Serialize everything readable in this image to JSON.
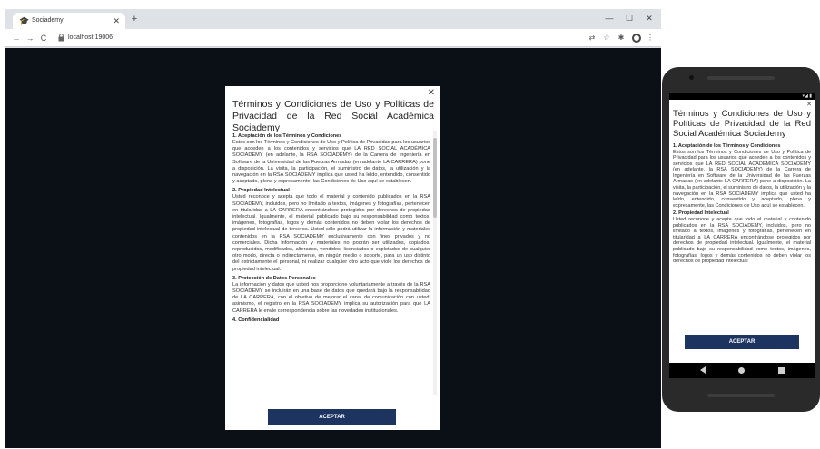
{
  "browser": {
    "tab_title": "Sociademy",
    "url": "localhost:19006",
    "icons": [
      "back-icon",
      "forward-icon",
      "reload-icon",
      "lock-icon",
      "translate-icon",
      "star-icon",
      "extensions-icon",
      "profile-icon",
      "menu-icon"
    ],
    "window_controls": {
      "minimize": "—",
      "maximize": "☐",
      "close": "✕"
    },
    "new_tab": "+",
    "tab_close": "✕"
  },
  "modal": {
    "close": "✕",
    "title": "Términos y Condiciones de Uso y Políticas de Privacidad de la Red Social Académica Sociademy",
    "sections": [
      {
        "heading": "1. Aceptación de los Términos y Condiciones",
        "text": "Estos son los Términos y Condiciones de Uso y Política de Privacidad para los usuarios que acceden a los contenidos y servicios que LA RED SOCIAL ACADÉMICA SOCIADEMY (en adelante, la RSA SOCIADEMY) de la Carrera de Ingeniería en Software de la Universidad de las Fuerzas Armadas (en adelante LA CARRERA) pone a disposición. La visita, la participación, el suministro de datos, la utilización y la navegación en la RSA SOCIADEMY implica que usted ha leído, entendido, consentido y aceptado, plena y expresamente, las Condiciones de Uso aquí se establecen."
      },
      {
        "heading": "2. Propiedad Intelectual",
        "text": "Usted reconoce y acepta que todo el material y contenido publicados en la RSA SOCIADEMY, incluidos, pero no limitado a textos, imágenes y fotografías, pertenecen en titularidad a LA CARRERA encontrándose protegidos por derechos de propiedad intelectual. Igualmente, el material publicado bajo su responsabilidad como textos, imágenes, fotografías, logos y demás contenidos no deben violar los derechos de propiedad intelectual de terceros. Usted sólo podrá utilizar la información y materiales contenidos en la RSA SOCIADEMY exclusivamente con fines privados y no comerciales. Dicha información y materiales no podrán ser utilizados, copiados, reproducidos, modificados, alterados, vendidos, licenciados o explotados de cualquier otro modo, directa o indirectamente, en ningún medio o soporte, para un uso distinto del estrictamente el personal, ni realizar cualquier otro acto que viole los derechos de propiedad intelectual."
      },
      {
        "heading": "3. Protección de Datos Personales",
        "text": "La información y datos que usted nos proporcione voluntariamente a través de la RSA SOCIADEMY se incluirán en una base de datos que quedará bajo la responsabilidad de LA CARRERA, con el objetivo de mejorar el canal de comunicación con usted, asimismo, el registro en la RSA SOCIADEMY implica su autorización para que LA CARRERA le envíe correspondencia sobre las novedades institucionales."
      },
      {
        "heading": "4. Confidencialidad",
        "text": ""
      }
    ],
    "accept_label": "ACEPTAR"
  },
  "phone": {
    "status_icons": "▾◢ ▮",
    "close": "✕",
    "title": "Términos y Condiciones de Uso y Políticas de Privacidad de la Red Social Académica Sociademy",
    "sections": [
      {
        "heading": "1. Aceptación de los Términos y Condiciones",
        "text": "Estos son los Términos y Condiciones de Uso y Política de Privacidad para los usuarios que acceden a los contenidos y servicios que LA RED SOCIAL ACADÉMICA SOCIADEMY (en adelante, la RSA SOCIADEMY) de la Carrera de Ingeniería en Software de la Universidad de las Fuerzas Armadas (en adelante LA CARRERA) pone a disposición. La visita, la participación, el suministro de datos, la utilización y la navegación en la RSA SOCIADEMY implica que usted ha leído, entendido, consentido y aceptado, plena y expresamente, las Condiciones de Uso aquí se establecen."
      },
      {
        "heading": "2. Propiedad Intelectual",
        "text": "Usted reconoce y acepta que todo el material y contenido publicados en la RSA SOCIADEMY, incluidos, pero no limitado a textos, imágenes y fotografías, pertenecen en titularidad a LA CARRERA encontrándose protegidos por derechos de propiedad intelectual. Igualmente, el material publicado bajo su responsabilidad como textos, imágenes, fotografías, logos y demás contenidos no deben violar los derechos de propiedad intelectual"
      }
    ],
    "accept_label": "ACEPTAR"
  },
  "colors": {
    "accent": "#1d3461",
    "page_background": "#0b1016",
    "browser_chrome": "#dee1e6"
  }
}
